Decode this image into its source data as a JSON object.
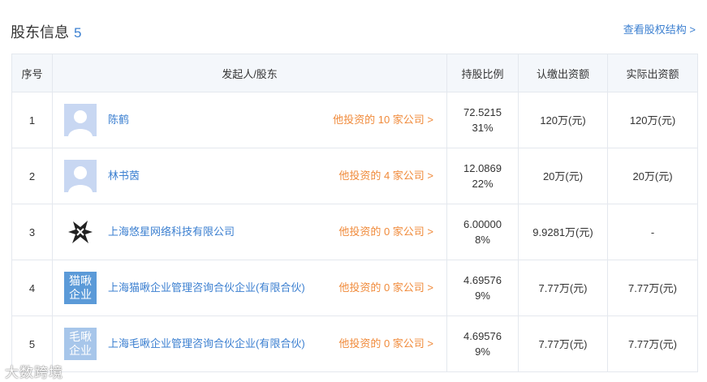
{
  "header": {
    "title": "股东信息",
    "count": "5",
    "structure_link": "查看股权结构 >"
  },
  "table": {
    "columns": [
      "序号",
      "发起人/股东",
      "持股比例",
      "认缴出资额",
      "实际出资额"
    ],
    "rows": [
      {
        "index": "1",
        "name": "陈鹤",
        "invest": "他投资的 10 家公司 >",
        "ratio_value": "72.5215",
        "ratio_percent": "31%",
        "subscribed": "120万(元)",
        "actual": "120万(元)",
        "avatar": "default-avatar"
      },
      {
        "index": "2",
        "name": "林书茵",
        "invest": "他投资的 4 家公司 >",
        "ratio_value": "12.0869",
        "ratio_percent": "22%",
        "subscribed": "20万(元)",
        "actual": "20万(元)",
        "avatar": "default-avatar"
      },
      {
        "index": "3",
        "name": "上海悠星网络科技有限公司",
        "invest": "他投资的 0 家公司 >",
        "ratio_value": "6.00000",
        "ratio_percent": "8%",
        "subscribed": "9.9281万(元)",
        "actual": "-",
        "avatar": "company-logo"
      },
      {
        "index": "4",
        "name": "上海猫啾企业管理咨询合伙企业(有限合伙)",
        "invest": "他投资的 0 家公司 >",
        "ratio_value": "4.69576",
        "ratio_percent": "9%",
        "subscribed": "7.77万(元)",
        "actual": "7.77万(元)",
        "avatar_line1": "猫啾",
        "avatar_line2": "企业"
      },
      {
        "index": "5",
        "name": "上海毛啾企业管理咨询合伙企业(有限合伙)",
        "invest": "他投资的 0 家公司 >",
        "ratio_value": "4.69576",
        "ratio_percent": "9%",
        "subscribed": "7.77万(元)",
        "actual": "7.77万(元)",
        "avatar_line1": "毛啾",
        "avatar_line2": "企业"
      }
    ]
  },
  "watermark": "大数跨境",
  "colors": {
    "link": "#3b7fd0",
    "invest": "#f08a3a",
    "header_bg": "#f4f7fb",
    "border": "#e4e8ee"
  }
}
